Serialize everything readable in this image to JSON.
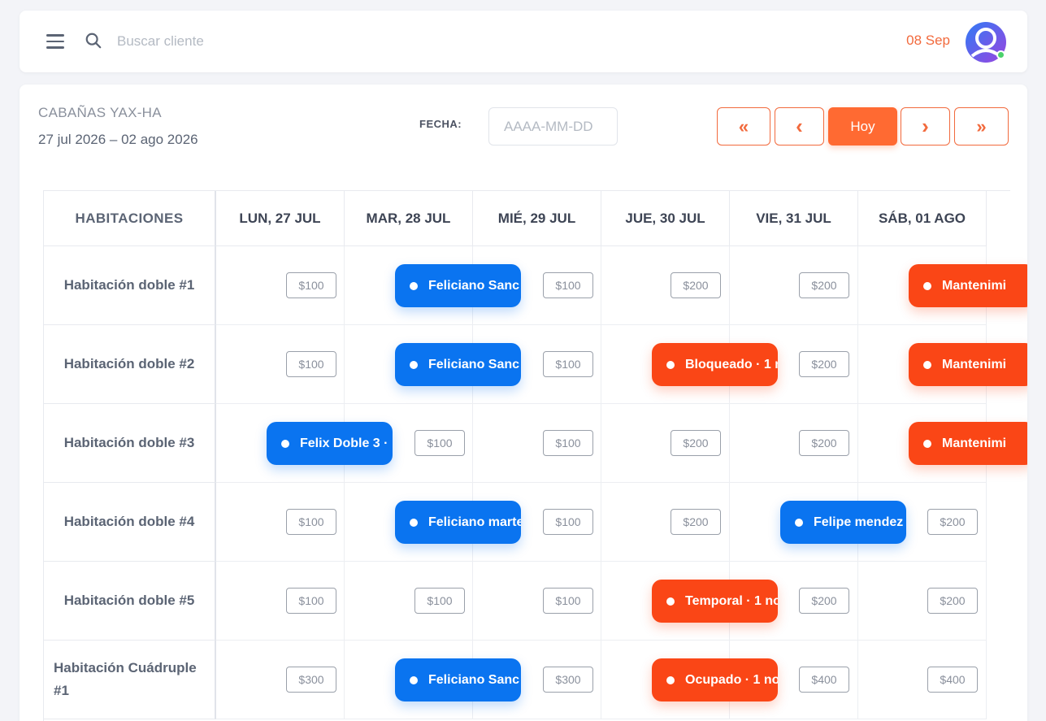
{
  "header": {
    "search_placeholder": "Buscar cliente",
    "date": "08 Sep"
  },
  "property": {
    "name": "CABAÑAS YAX-HA",
    "range": "27 jul 2026 – 02 ago 2026"
  },
  "filter": {
    "fecha_label": "FECHA:",
    "fecha_placeholder": "AAAA-MM-DD"
  },
  "nav": {
    "first": "«",
    "prev": "‹",
    "today": "Hoy",
    "next": "›",
    "last": "»"
  },
  "calendar": {
    "rooms_header": "HABITACIONES",
    "days": [
      "LUN, 27 JUL",
      "MAR, 28 JUL",
      "MIÉ, 29 JUL",
      "JUE, 30 JUL",
      "VIE, 31 JUL",
      "SÁB, 01 AGO"
    ],
    "rooms": [
      "Habitación doble #1",
      "Habitación doble #2",
      "Habitación doble #3",
      "Habitación doble #4",
      "Habitación doble #5",
      "Habitación Cuádruple #1"
    ],
    "prices": [
      [
        "$100",
        "",
        "$100",
        "$200",
        "$200",
        ""
      ],
      [
        "$100",
        "",
        "$100",
        "",
        "$200",
        ""
      ],
      [
        "",
        "$100",
        "$100",
        "$200",
        "$200",
        ""
      ],
      [
        "$100",
        "",
        "$100",
        "$200",
        "",
        "$200"
      ],
      [
        "$100",
        "$100",
        "$100",
        "",
        "$200",
        "$200"
      ],
      [
        "$300",
        "",
        "$300",
        "",
        "$400",
        "$400"
      ]
    ],
    "reservations": [
      {
        "row": 0,
        "col": 1,
        "label": "Feliciano Sanc",
        "type": "blue"
      },
      {
        "row": 0,
        "col": 5,
        "label": "Mantenimi",
        "type": "red"
      },
      {
        "row": 1,
        "col": 1,
        "label": "Feliciano Sanc",
        "type": "blue"
      },
      {
        "row": 1,
        "col": 3,
        "label": "Bloqueado · 1 n",
        "type": "red"
      },
      {
        "row": 1,
        "col": 5,
        "label": "Mantenimi",
        "type": "red"
      },
      {
        "row": 2,
        "col": 0,
        "label": "Felix Doble 3 ·",
        "type": "blue"
      },
      {
        "row": 2,
        "col": 5,
        "label": "Mantenimi",
        "type": "red"
      },
      {
        "row": 3,
        "col": 1,
        "label": "Feliciano marte",
        "type": "blue"
      },
      {
        "row": 3,
        "col": 4,
        "label": "Felipe mendez",
        "type": "blue"
      },
      {
        "row": 4,
        "col": 3,
        "label": "Temporal · 1 no",
        "type": "red"
      },
      {
        "row": 5,
        "col": 1,
        "label": "Feliciano Sanc",
        "type": "blue"
      },
      {
        "row": 5,
        "col": 3,
        "label": "Ocupado · 1 no",
        "type": "red"
      }
    ]
  },
  "colors": {
    "accent": "#f26a3d",
    "reservation_blue": "#0a74f0",
    "reservation_red": "#fa4616"
  }
}
